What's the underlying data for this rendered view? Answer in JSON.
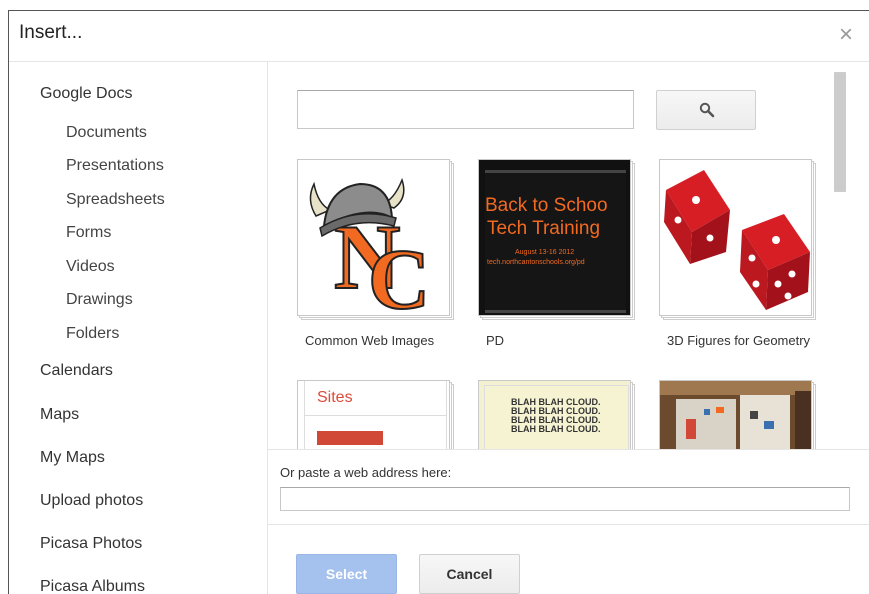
{
  "dialog": {
    "title": "Insert...",
    "close_glyph": "×"
  },
  "sidebar": {
    "google_docs": "Google Docs",
    "docs_items": [
      {
        "label": "Documents"
      },
      {
        "label": "Presentations"
      },
      {
        "label": "Spreadsheets"
      },
      {
        "label": "Forms"
      },
      {
        "label": "Videos"
      },
      {
        "label": "Drawings"
      },
      {
        "label": "Folders"
      }
    ],
    "calendars": "Calendars",
    "maps": "Maps",
    "my_maps": "My Maps",
    "upload_photos": "Upload photos",
    "picasa_photos": "Picasa Photos",
    "picasa_albums": "Picasa Albums"
  },
  "search": {
    "value": "",
    "icon": "search-icon"
  },
  "tiles": [
    {
      "label": "Common Web Images",
      "thumb": "nc-viking-logo"
    },
    {
      "label": "PD",
      "thumb": "back-to-school-slide",
      "slide_line1": "Back to Schoo",
      "slide_line2": "Tech Training",
      "slide_line3": "August 13-16  2012",
      "slide_line4": "tech.northcantonschools.org/pd"
    },
    {
      "label": "3D Figures for Geometry",
      "thumb": "red-dice"
    },
    {
      "label": "",
      "thumb": "sites-page",
      "sites_text": "Sites"
    },
    {
      "label": "",
      "thumb": "blah-cloud",
      "blah_lines": [
        "BLAH BLAH CLOUD.",
        "BLAH BLAH CLOUD.",
        "BLAH BLAH CLOUD.",
        "BLAH BLAH CLOUD."
      ]
    },
    {
      "label": "",
      "thumb": "room-photo"
    }
  ],
  "paste": {
    "label": "Or paste a web address here:",
    "value": ""
  },
  "buttons": {
    "select": "Select",
    "cancel": "Cancel"
  },
  "colors": {
    "select_button": "#a5c1ee",
    "orange": "#f26a21",
    "dice_red": "#c8161d"
  }
}
